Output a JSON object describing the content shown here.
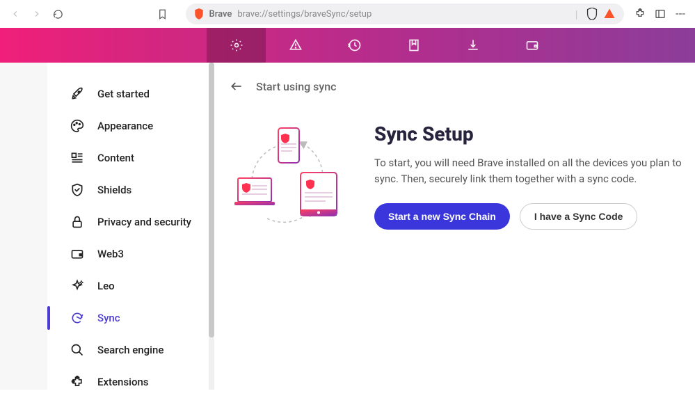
{
  "address": {
    "site": "Brave",
    "url": "brave://settings/braveSync/setup"
  },
  "sidebar": {
    "items": [
      {
        "label": "Get started"
      },
      {
        "label": "Appearance"
      },
      {
        "label": "Content"
      },
      {
        "label": "Shields"
      },
      {
        "label": "Privacy and security"
      },
      {
        "label": "Web3"
      },
      {
        "label": "Leo"
      },
      {
        "label": "Sync"
      },
      {
        "label": "Search engine"
      },
      {
        "label": "Extensions"
      }
    ]
  },
  "page": {
    "header": "Start using sync",
    "heading": "Sync Setup",
    "description": "To start, you will need Brave installed on all the devices you plan to sync. Then, securely link them together with a sync code.",
    "primary_btn": "Start a new Sync Chain",
    "secondary_btn": "I have a Sync Code"
  },
  "colors": {
    "accent": "#3a36db",
    "nav_active": "#4c3ccf"
  }
}
